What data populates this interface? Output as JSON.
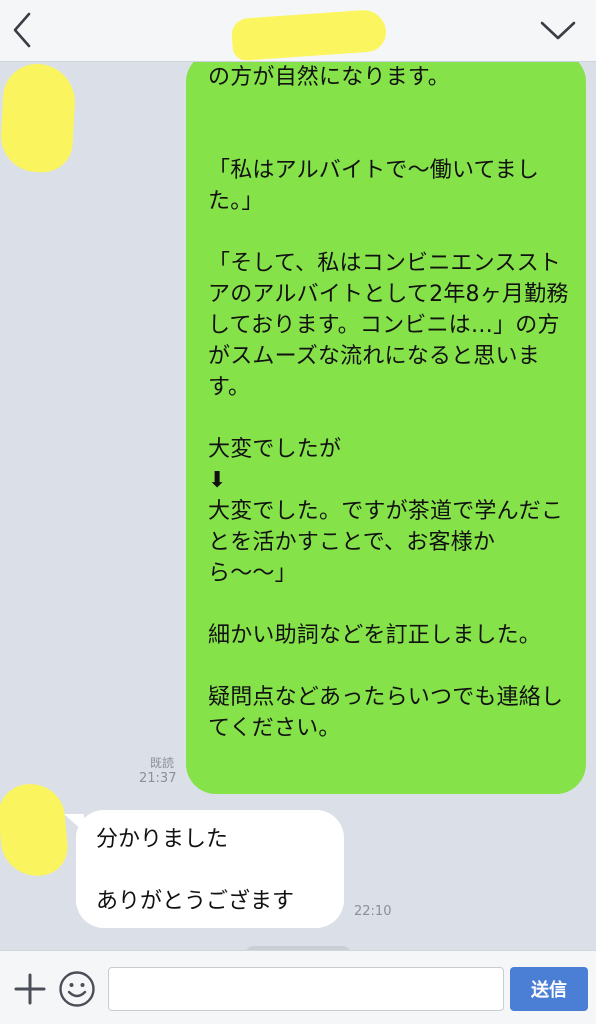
{
  "header": {
    "title": ""
  },
  "messages": {
    "outgoing": {
      "text": "の方が自然になります。\n\n\n「私はアルバイトで〜働いてました。」\n\n「そして、私はコンビニエンスストアのアルバイトとして2年8ヶ月勤務しております。コンビニは…」の方がスムーズな流れになると思います。\n\n大変でしたが\n⬇\n大変でした。ですが茶道で学んだことを活かすことで、お客様から〜〜」\n\n細かい助詞などを訂正しました。\n\n疑問点などあったらいつでも連絡してください。",
      "read_label": "既読",
      "time": "21:37"
    },
    "incoming": {
      "text": "分かりました\n\nありがとうござます",
      "time": "22:10"
    }
  },
  "composer": {
    "placeholder": "",
    "value": "",
    "send_label": "送信"
  },
  "icons": {
    "back": "chevron-left-icon",
    "menu": "chevron-down-icon",
    "add": "plus-icon",
    "emoji": "smiley-icon"
  },
  "colors": {
    "background": "#dbe0e8",
    "outgoing_bubble": "#85e249",
    "incoming_bubble": "#ffffff",
    "send_button": "#4b7fd6",
    "redaction": "#fbf55a"
  }
}
